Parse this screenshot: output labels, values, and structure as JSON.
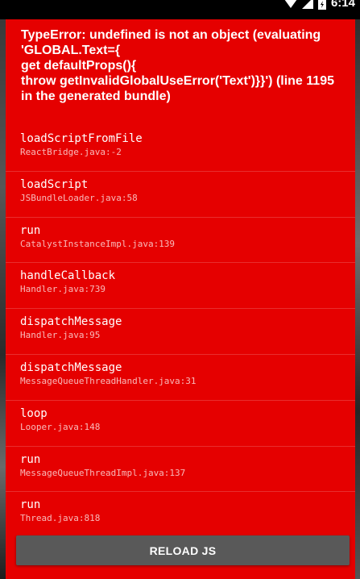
{
  "status_bar": {
    "time": "6:14",
    "icons": [
      "wifi-icon",
      "signal-icon",
      "battery-icon"
    ]
  },
  "error": {
    "message": "TypeError: undefined is not an object (evaluating 'GLOBAL.Text={\nget defaultProps(){\nthrow getInvalidGlobalUseError('Text')}}') (line 1195 in the generated bundle)"
  },
  "stack": [
    {
      "method": "loadScriptFromFile",
      "location": "ReactBridge.java:-2"
    },
    {
      "method": "loadScript",
      "location": "JSBundleLoader.java:58"
    },
    {
      "method": "run",
      "location": "CatalystInstanceImpl.java:139"
    },
    {
      "method": "handleCallback",
      "location": "Handler.java:739"
    },
    {
      "method": "dispatchMessage",
      "location": "Handler.java:95"
    },
    {
      "method": "dispatchMessage",
      "location": "MessageQueueThreadHandler.java:31"
    },
    {
      "method": "loop",
      "location": "Looper.java:148"
    },
    {
      "method": "run",
      "location": "MessageQueueThreadImpl.java:137"
    },
    {
      "method": "run",
      "location": "Thread.java:818"
    }
  ],
  "reload_button": {
    "label": "RELOAD JS"
  },
  "colors": {
    "background": "#e50000",
    "button": "#595959",
    "text": "#ffffff"
  }
}
